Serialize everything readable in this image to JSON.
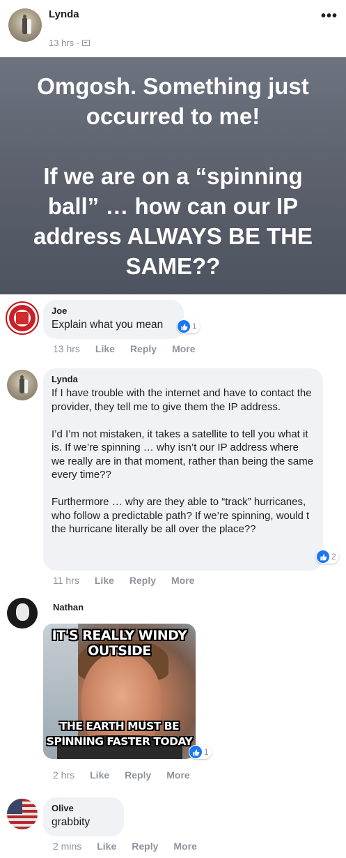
{
  "post": {
    "author": "Lynda",
    "time": "13 hrs ·",
    "more": "•••",
    "status_text": "Omgosh. Something just occurred to me!\n\nIf we are on a “spinning ball” … how can our IP address ALWAYS BE THE SAME??",
    "status_bg": "#5a5f6b"
  },
  "actions": {
    "like": "Like",
    "reply": "Reply",
    "more": "More"
  },
  "comments": [
    {
      "author": "Joe",
      "text": "Explain what you mean",
      "time": "13 hrs",
      "reactions": "1"
    },
    {
      "author": "Lynda",
      "text": "If I have trouble with the internet and have to contact the provider, they tell me to give them the IP address.\n\nI’d I’m not mistaken, it takes a satellite to tell you what it is. If we’re spinning … why isn’t our IP address where we really are in that moment, rather than being the same every time??\n\nFurthermore … why are they able to “track” hurricanes, who follow a predictable path? If we’re spinning, would t the hurricane literally be all over the place??",
      "time": "11 hrs",
      "reactions": "2"
    },
    {
      "author": "Nathan",
      "meme_top": "IT'S REALLY WINDY\nOUTSIDE",
      "meme_bottom": "THE EARTH MUST BE\nSPINNING FASTER TODAY",
      "time": "2 hrs",
      "reactions": "1"
    },
    {
      "author": "Olive",
      "text": "grabbity",
      "time": "2 mins"
    }
  ],
  "colors": {
    "like_blue": "#1877f2",
    "bubble": "#f0f2f5",
    "meta": "#8d949e"
  },
  "icons": [
    "more-icon",
    "audience-icon",
    "like-reaction-icon"
  ]
}
